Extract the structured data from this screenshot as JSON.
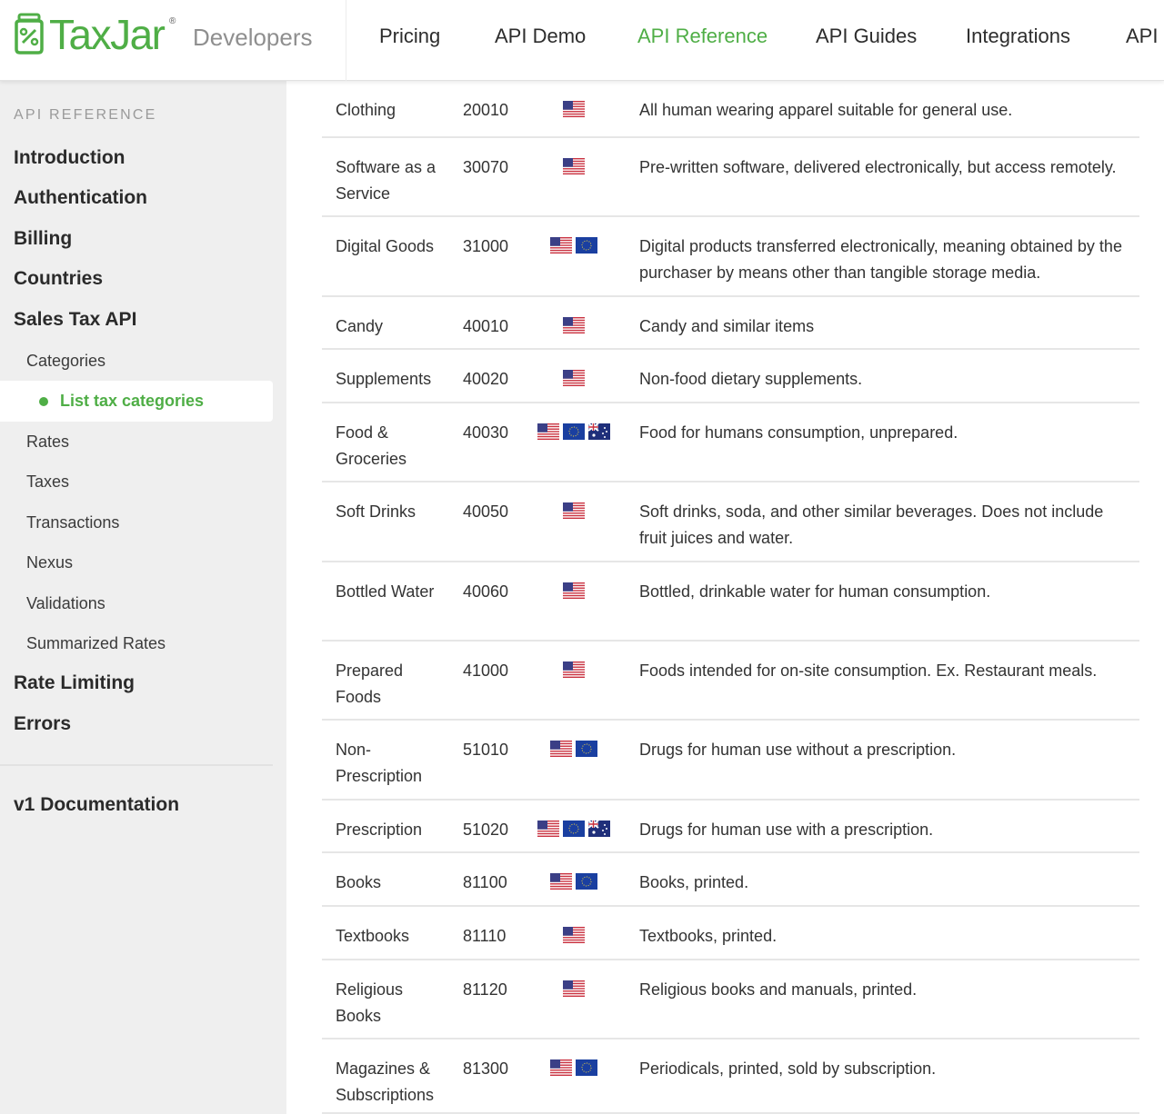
{
  "header": {
    "brand": "TaxJar",
    "brand_reg": "®",
    "subtitle": "Developers",
    "nav": [
      {
        "label": "Pricing",
        "active": false
      },
      {
        "label": "API Demo",
        "active": false
      },
      {
        "label": "API Reference",
        "active": true
      },
      {
        "label": "API Guides",
        "active": false
      },
      {
        "label": "Integrations",
        "active": false
      },
      {
        "label": "API S",
        "active": false
      }
    ]
  },
  "sidebar": {
    "heading": "API REFERENCE",
    "top_items": [
      "Introduction",
      "Authentication",
      "Billing",
      "Countries",
      "Sales Tax API"
    ],
    "categories_label": "Categories",
    "active_item": "List tax categories",
    "sub_items": [
      "Rates",
      "Taxes",
      "Transactions",
      "Nexus",
      "Validations",
      "Summarized Rates"
    ],
    "bottom_items": [
      "Rate Limiting",
      "Errors"
    ],
    "footer_item": "v1 Documentation"
  },
  "colors": {
    "accent": "#4fae46",
    "sidebar_bg": "#efefef"
  },
  "table": {
    "rows": [
      {
        "name": "Clothing",
        "code": "20010",
        "flags": [
          "us-flag-icon"
        ],
        "description": "All human wearing apparel suitable for general use."
      },
      {
        "name": "Software as a Service",
        "code": "30070",
        "flags": [
          "us-flag-icon"
        ],
        "description": "Pre-written software, delivered electronically, but access remotely."
      },
      {
        "name": "Digital Goods",
        "code": "31000",
        "flags": [
          "us-flag-icon",
          "eu-flag-icon"
        ],
        "description": "Digital products transferred electronically, meaning obtained by the purchaser by means other than tangible storage media."
      },
      {
        "name": "Candy",
        "code": "40010",
        "flags": [
          "us-flag-icon"
        ],
        "description": "Candy and similar items"
      },
      {
        "name": "Supplements",
        "code": "40020",
        "flags": [
          "us-flag-icon"
        ],
        "description": "Non-food dietary supplements."
      },
      {
        "name": "Food & Groceries",
        "code": "40030",
        "flags": [
          "us-flag-icon",
          "eu-flag-icon",
          "au-flag-icon"
        ],
        "description": "Food for humans consumption, unprepared."
      },
      {
        "name": "Soft Drinks",
        "code": "40050",
        "flags": [
          "us-flag-icon"
        ],
        "description": "Soft drinks, soda, and other similar beverages. Does not include fruit juices and water."
      },
      {
        "name": "Bottled Water",
        "code": "40060",
        "flags": [
          "us-flag-icon"
        ],
        "description": "Bottled, drinkable water for human consumption."
      },
      {
        "name": "Prepared Foods",
        "code": "41000",
        "flags": [
          "us-flag-icon"
        ],
        "description": "Foods intended for on-site consumption. Ex. Restaurant meals."
      },
      {
        "name": "Non-Prescription",
        "code": "51010",
        "flags": [
          "us-flag-icon",
          "eu-flag-icon"
        ],
        "description": "Drugs for human use without a prescription."
      },
      {
        "name": "Prescription",
        "code": "51020",
        "flags": [
          "us-flag-icon",
          "eu-flag-icon",
          "au-flag-icon"
        ],
        "description": "Drugs for human use with a prescription."
      },
      {
        "name": "Books",
        "code": "81100",
        "flags": [
          "us-flag-icon",
          "eu-flag-icon"
        ],
        "description": "Books, printed."
      },
      {
        "name": "Textbooks",
        "code": "81110",
        "flags": [
          "us-flag-icon"
        ],
        "description": "Textbooks, printed."
      },
      {
        "name": "Religious Books",
        "code": "81120",
        "flags": [
          "us-flag-icon"
        ],
        "description": "Religious books and manuals, printed."
      },
      {
        "name": "Magazines & Subscriptions",
        "code": "81300",
        "flags": [
          "us-flag-icon",
          "eu-flag-icon"
        ],
        "description": "Periodicals, printed, sold by subscription."
      }
    ]
  }
}
